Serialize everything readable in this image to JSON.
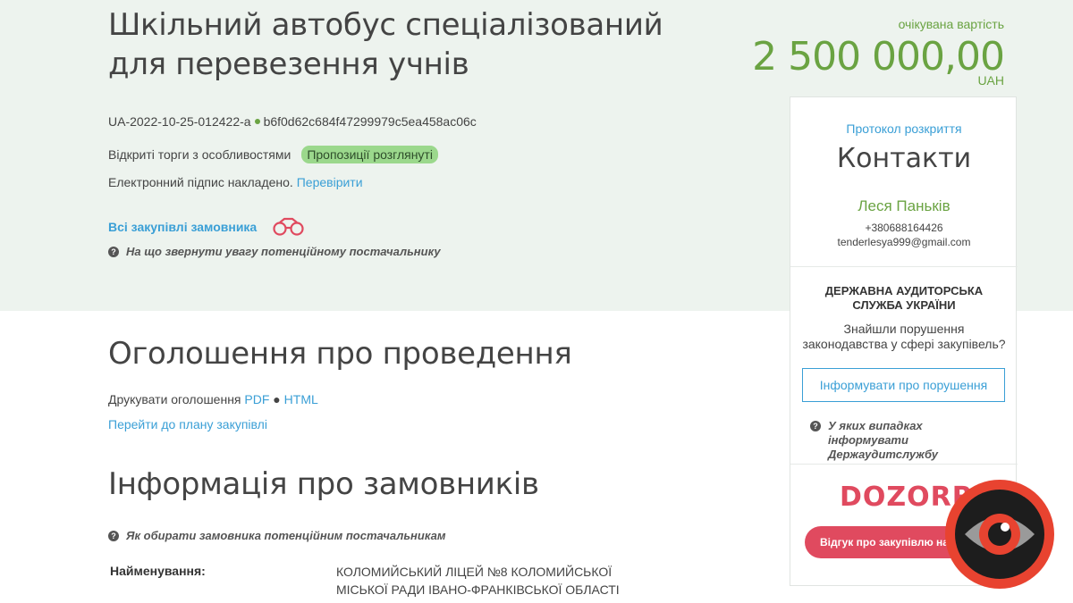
{
  "header": {
    "title_line1": "Шкільний автобус спеціалізований",
    "title_line2": "для перевезення учнів",
    "price_label": "очікувана вартість",
    "price": "2 500 000,00",
    "currency": "UAH",
    "tender_id": "UA-2022-10-25-012422-a",
    "tender_hash": "b6f0d62c684f47299979c5ea458ac06c",
    "procedure_type": "Відкриті торги з особливостями",
    "status_badge": "Пропозиції розглянуті",
    "signature_text": "Електронний підпис накладено.",
    "signature_link": "Перевірити",
    "all_buyer_link": "Всі закупівлі замовника",
    "hint": "На що звернути увагу потенційному постачальнику"
  },
  "announcement": {
    "heading": "Оголошення про проведення",
    "print_label": "Друкувати оголошення",
    "pdf_link": "PDF",
    "separator": "●",
    "html_link": "HTML",
    "plan_link": "Перейти до плану закупівлі"
  },
  "buyers": {
    "heading": "Інформація про замовників",
    "hint": "Як обирати замовника потенційним постачальникам",
    "name_label": "Найменування:",
    "name_line1": "КОЛОМИЙСЬКИЙ ЛІЦЕЙ №8 КОЛОМИЙСЬКОЇ",
    "name_line2": "МІСЬКОЇ РАДИ ІВАНО-ФРАНКІВСЬКОЇ ОБЛАСТІ"
  },
  "sidebar": {
    "protocol_link": "Протокол розкриття",
    "contacts_title": "Контакти",
    "person": "Леся Паньків",
    "phone": "+380688164426",
    "email": "tenderlesya999@gmail.com",
    "das_line1": "ДЕРЖАВНА АУДИТОРСЬКА",
    "das_line2": "СЛУЖБА УКРАЇНИ",
    "das_q_line1": "Знайшли порушення",
    "das_q_line2": "законодавства у сфері закупівель?",
    "report_button": "Інформувати про порушення",
    "cases_line1": "У яких випадках інформувати",
    "cases_line2": "Держаудитслужбу",
    "dozorro_logo": "DOZORRO",
    "feedback_button": "Відгук про закупівлю на ДОZORRO"
  },
  "colors": {
    "accent_green": "#6aa342",
    "link_blue": "#3a9fd6",
    "hero_bg": "#edf3ee",
    "dozorro_red": "#e04a5f",
    "badge_green": "#9bd88c"
  }
}
